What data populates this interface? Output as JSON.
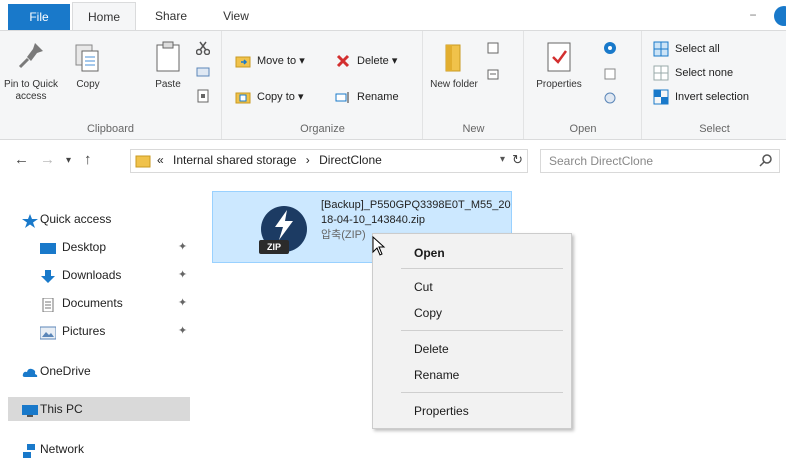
{
  "ribbon_tabs": {
    "file": "File",
    "home": "Home",
    "share": "Share",
    "view": "View"
  },
  "window": {
    "minimize_glyph": "−"
  },
  "clipboard": {
    "pin_label": "Pin to Quick access",
    "copy_label": "Copy",
    "paste_label": "Paste",
    "group_label": "Clipboard"
  },
  "organize": {
    "move_to": "Move to",
    "copy_to": "Copy to",
    "delete": "Delete",
    "rename": "Rename",
    "group_label": "Organize"
  },
  "new": {
    "new_folder": "New folder",
    "group_label": "New"
  },
  "open": {
    "properties": "Properties",
    "group_label": "Open"
  },
  "select": {
    "select_all": "Select all",
    "select_none": "Select none",
    "invert_selection": "Invert selection",
    "group_label": "Select"
  },
  "navigation": {
    "back_glyph": "←",
    "forward_glyph": "→",
    "recent_glyph": "▾",
    "up_glyph": "↑",
    "overflow_glyph": "«",
    "crumbs": [
      "Internal shared storage",
      "›",
      "DirectClone"
    ],
    "dropdown_glyph": "▾",
    "refresh_glyph": "↻",
    "search_placeholder": "Search DirectClone"
  },
  "nav_pane": {
    "quick_access": "Quick access",
    "desktop": "Desktop",
    "downloads": "Downloads",
    "documents": "Documents",
    "pictures": "Pictures",
    "onedrive": "OneDrive",
    "this_pc": "This PC",
    "network": "Network",
    "pin_glyph": "✦"
  },
  "file": {
    "name": "[Backup]_P550GPQ3398E0T_M55_2018-04-10_143840.zip",
    "type_label": "압축(ZIP)",
    "badge": "ZIP"
  },
  "context_menu": {
    "items": [
      "Open",
      "Cut",
      "Copy",
      "Delete",
      "Rename",
      "Properties"
    ]
  },
  "colors": {
    "accent": "#1979ca",
    "selection": "#cce8ff",
    "ribbon_bg": "#f5f6f7",
    "delete_red": "#d32f2f"
  }
}
